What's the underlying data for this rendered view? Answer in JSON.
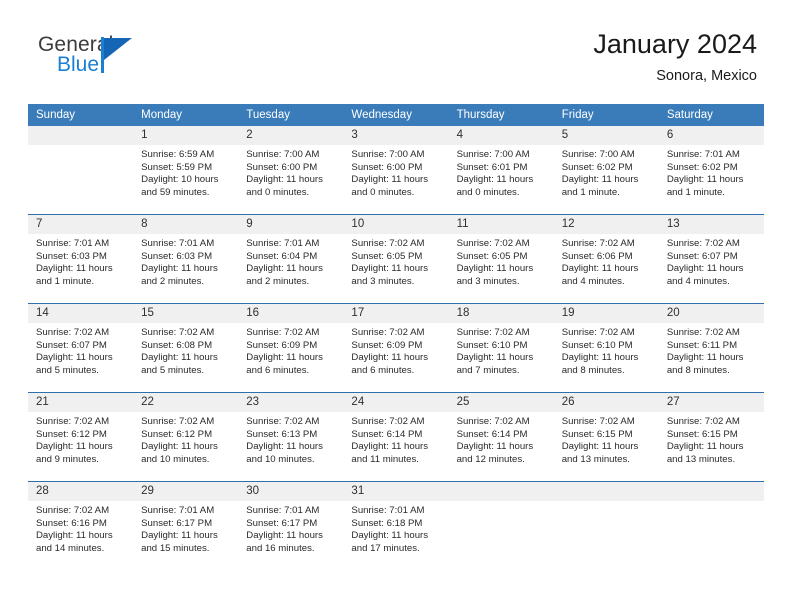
{
  "brand": {
    "name_part1": "General",
    "name_part2": "Blue",
    "logo_icon": "triangle-flag-icon"
  },
  "header": {
    "title": "January 2024",
    "subtitle": "Sonora, Mexico"
  },
  "calendar": {
    "weekday_headers": [
      "Sunday",
      "Monday",
      "Tuesday",
      "Wednesday",
      "Thursday",
      "Friday",
      "Saturday"
    ],
    "header_bg": "#3a7cb9",
    "daynum_bg": "#f0f0f0",
    "row_border": "#2f6fad",
    "weeks": [
      [
        {
          "day": "",
          "lines": []
        },
        {
          "day": "1",
          "lines": [
            "Sunrise: 6:59 AM",
            "Sunset: 5:59 PM",
            "Daylight: 10 hours",
            "and 59 minutes."
          ]
        },
        {
          "day": "2",
          "lines": [
            "Sunrise: 7:00 AM",
            "Sunset: 6:00 PM",
            "Daylight: 11 hours",
            "and 0 minutes."
          ]
        },
        {
          "day": "3",
          "lines": [
            "Sunrise: 7:00 AM",
            "Sunset: 6:00 PM",
            "Daylight: 11 hours",
            "and 0 minutes."
          ]
        },
        {
          "day": "4",
          "lines": [
            "Sunrise: 7:00 AM",
            "Sunset: 6:01 PM",
            "Daylight: 11 hours",
            "and 0 minutes."
          ]
        },
        {
          "day": "5",
          "lines": [
            "Sunrise: 7:00 AM",
            "Sunset: 6:02 PM",
            "Daylight: 11 hours",
            "and 1 minute."
          ]
        },
        {
          "day": "6",
          "lines": [
            "Sunrise: 7:01 AM",
            "Sunset: 6:02 PM",
            "Daylight: 11 hours",
            "and 1 minute."
          ]
        }
      ],
      [
        {
          "day": "7",
          "lines": [
            "Sunrise: 7:01 AM",
            "Sunset: 6:03 PM",
            "Daylight: 11 hours",
            "and 1 minute."
          ]
        },
        {
          "day": "8",
          "lines": [
            "Sunrise: 7:01 AM",
            "Sunset: 6:03 PM",
            "Daylight: 11 hours",
            "and 2 minutes."
          ]
        },
        {
          "day": "9",
          "lines": [
            "Sunrise: 7:01 AM",
            "Sunset: 6:04 PM",
            "Daylight: 11 hours",
            "and 2 minutes."
          ]
        },
        {
          "day": "10",
          "lines": [
            "Sunrise: 7:02 AM",
            "Sunset: 6:05 PM",
            "Daylight: 11 hours",
            "and 3 minutes."
          ]
        },
        {
          "day": "11",
          "lines": [
            "Sunrise: 7:02 AM",
            "Sunset: 6:05 PM",
            "Daylight: 11 hours",
            "and 3 minutes."
          ]
        },
        {
          "day": "12",
          "lines": [
            "Sunrise: 7:02 AM",
            "Sunset: 6:06 PM",
            "Daylight: 11 hours",
            "and 4 minutes."
          ]
        },
        {
          "day": "13",
          "lines": [
            "Sunrise: 7:02 AM",
            "Sunset: 6:07 PM",
            "Daylight: 11 hours",
            "and 4 minutes."
          ]
        }
      ],
      [
        {
          "day": "14",
          "lines": [
            "Sunrise: 7:02 AM",
            "Sunset: 6:07 PM",
            "Daylight: 11 hours",
            "and 5 minutes."
          ]
        },
        {
          "day": "15",
          "lines": [
            "Sunrise: 7:02 AM",
            "Sunset: 6:08 PM",
            "Daylight: 11 hours",
            "and 5 minutes."
          ]
        },
        {
          "day": "16",
          "lines": [
            "Sunrise: 7:02 AM",
            "Sunset: 6:09 PM",
            "Daylight: 11 hours",
            "and 6 minutes."
          ]
        },
        {
          "day": "17",
          "lines": [
            "Sunrise: 7:02 AM",
            "Sunset: 6:09 PM",
            "Daylight: 11 hours",
            "and 6 minutes."
          ]
        },
        {
          "day": "18",
          "lines": [
            "Sunrise: 7:02 AM",
            "Sunset: 6:10 PM",
            "Daylight: 11 hours",
            "and 7 minutes."
          ]
        },
        {
          "day": "19",
          "lines": [
            "Sunrise: 7:02 AM",
            "Sunset: 6:10 PM",
            "Daylight: 11 hours",
            "and 8 minutes."
          ]
        },
        {
          "day": "20",
          "lines": [
            "Sunrise: 7:02 AM",
            "Sunset: 6:11 PM",
            "Daylight: 11 hours",
            "and 8 minutes."
          ]
        }
      ],
      [
        {
          "day": "21",
          "lines": [
            "Sunrise: 7:02 AM",
            "Sunset: 6:12 PM",
            "Daylight: 11 hours",
            "and 9 minutes."
          ]
        },
        {
          "day": "22",
          "lines": [
            "Sunrise: 7:02 AM",
            "Sunset: 6:12 PM",
            "Daylight: 11 hours",
            "and 10 minutes."
          ]
        },
        {
          "day": "23",
          "lines": [
            "Sunrise: 7:02 AM",
            "Sunset: 6:13 PM",
            "Daylight: 11 hours",
            "and 10 minutes."
          ]
        },
        {
          "day": "24",
          "lines": [
            "Sunrise: 7:02 AM",
            "Sunset: 6:14 PM",
            "Daylight: 11 hours",
            "and 11 minutes."
          ]
        },
        {
          "day": "25",
          "lines": [
            "Sunrise: 7:02 AM",
            "Sunset: 6:14 PM",
            "Daylight: 11 hours",
            "and 12 minutes."
          ]
        },
        {
          "day": "26",
          "lines": [
            "Sunrise: 7:02 AM",
            "Sunset: 6:15 PM",
            "Daylight: 11 hours",
            "and 13 minutes."
          ]
        },
        {
          "day": "27",
          "lines": [
            "Sunrise: 7:02 AM",
            "Sunset: 6:15 PM",
            "Daylight: 11 hours",
            "and 13 minutes."
          ]
        }
      ],
      [
        {
          "day": "28",
          "lines": [
            "Sunrise: 7:02 AM",
            "Sunset: 6:16 PM",
            "Daylight: 11 hours",
            "and 14 minutes."
          ]
        },
        {
          "day": "29",
          "lines": [
            "Sunrise: 7:01 AM",
            "Sunset: 6:17 PM",
            "Daylight: 11 hours",
            "and 15 minutes."
          ]
        },
        {
          "day": "30",
          "lines": [
            "Sunrise: 7:01 AM",
            "Sunset: 6:17 PM",
            "Daylight: 11 hours",
            "and 16 minutes."
          ]
        },
        {
          "day": "31",
          "lines": [
            "Sunrise: 7:01 AM",
            "Sunset: 6:18 PM",
            "Daylight: 11 hours",
            "and 17 minutes."
          ]
        },
        {
          "day": "",
          "lines": []
        },
        {
          "day": "",
          "lines": []
        },
        {
          "day": "",
          "lines": []
        }
      ]
    ]
  }
}
